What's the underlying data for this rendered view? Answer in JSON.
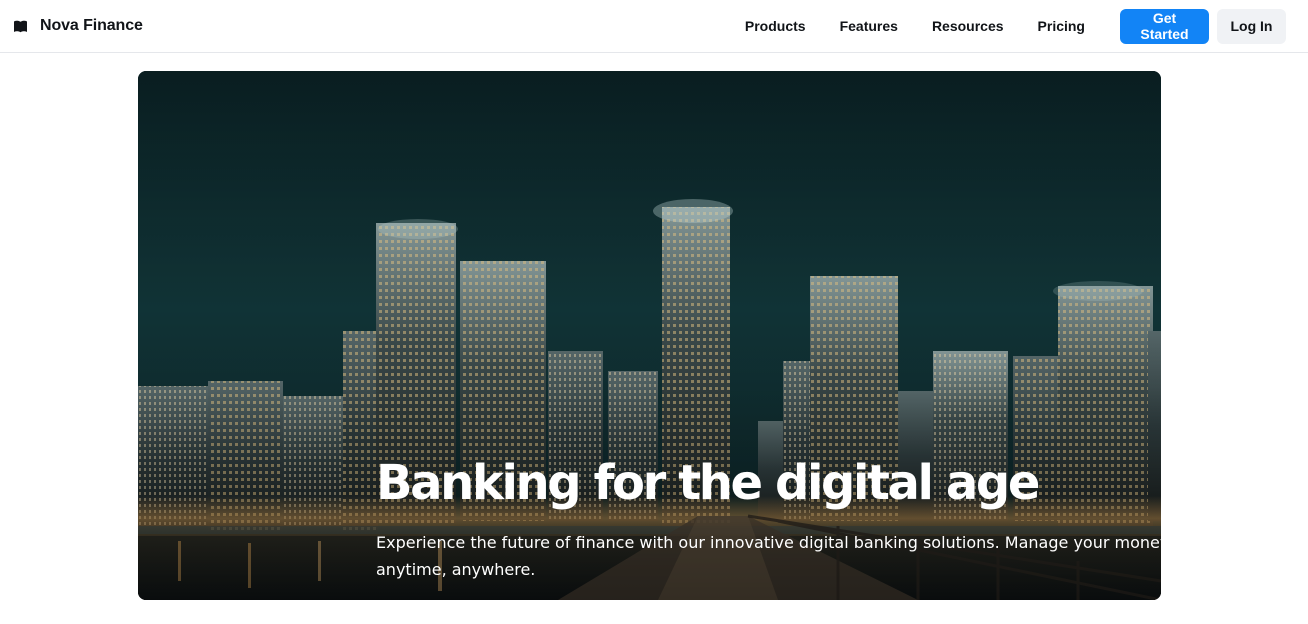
{
  "header": {
    "brand_name": "Nova Finance",
    "brand_icon": "book-icon",
    "nav": [
      {
        "label": "Products"
      },
      {
        "label": "Features"
      },
      {
        "label": "Resources"
      },
      {
        "label": "Pricing"
      }
    ],
    "get_started_label": "Get Started",
    "login_label": "Log In"
  },
  "hero": {
    "background": "night-city-skyline-photo",
    "title": "Banking for the digital age",
    "subtitle": "Experience the future of finance with our innovative digital banking solutions. Manage your money anytime, anywhere."
  },
  "colors": {
    "accent": "#1284f6",
    "secondary_button": "#f0f2f5",
    "text": "#111418"
  }
}
